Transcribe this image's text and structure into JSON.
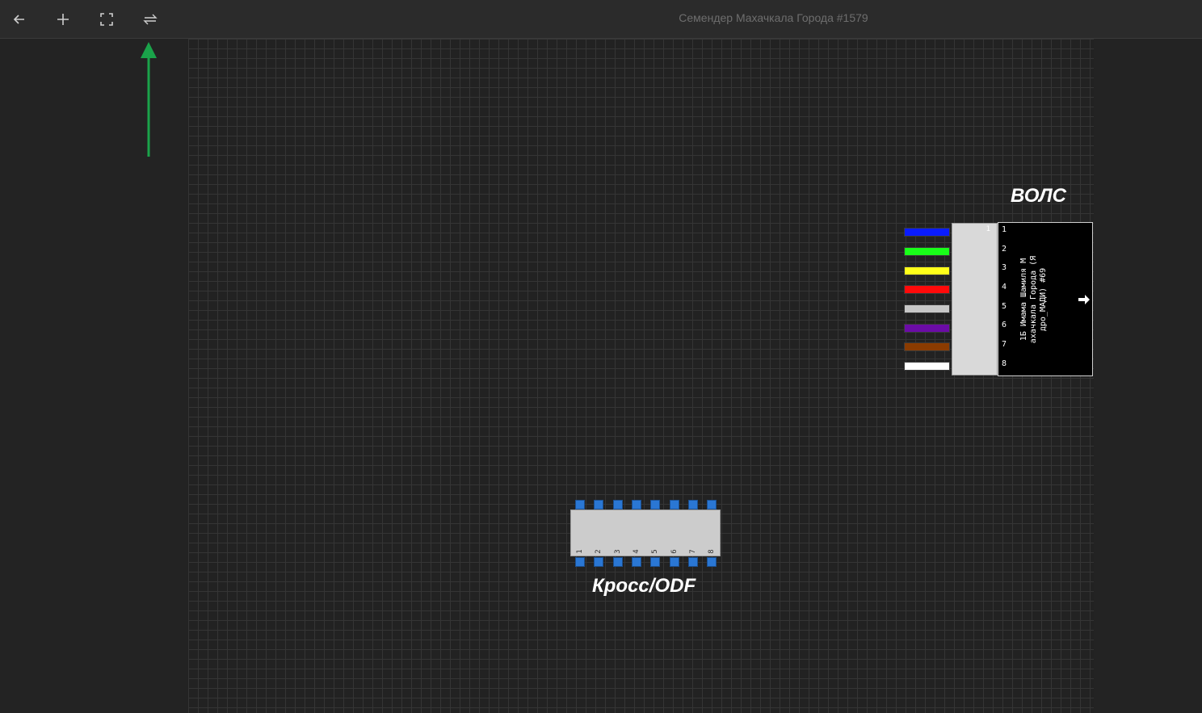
{
  "toolbar": {
    "title": "Семендер Махачкала Города #1579",
    "buttons": [
      {
        "name": "back-button",
        "icon": "arrow-left-icon"
      },
      {
        "name": "add-button",
        "icon": "plus-icon"
      },
      {
        "name": "fit-view-button",
        "icon": "fullscreen-icon"
      },
      {
        "name": "swap-button",
        "icon": "swap-arrows-icon"
      }
    ]
  },
  "guide_arrow": {
    "icon": "arrow-up-icon",
    "color": "#1aa34a"
  },
  "cable": {
    "title": "ВОЛС",
    "block_number": "1",
    "name": "1Б Имама Шамиля М ахачкала Города (Я дро_МАДИ) #69",
    "exit_icon": "arrow-right-icon",
    "fibers": [
      {
        "port": "1",
        "color": "#0a1cff"
      },
      {
        "port": "2",
        "color": "#19ff19"
      },
      {
        "port": "3",
        "color": "#ffff1a"
      },
      {
        "port": "4",
        "color": "#ff0a0a"
      },
      {
        "port": "5",
        "color": "#c7c7c7"
      },
      {
        "port": "6",
        "color": "#6b0ca6"
      },
      {
        "port": "7",
        "color": "#8a3b00"
      },
      {
        "port": "8",
        "color": "#ffffff"
      }
    ]
  },
  "odf": {
    "title": "Кросс/ODF",
    "ports": [
      "1",
      "2",
      "3",
      "4",
      "5",
      "6",
      "7",
      "8"
    ],
    "port_color": "#2a77d4"
  }
}
